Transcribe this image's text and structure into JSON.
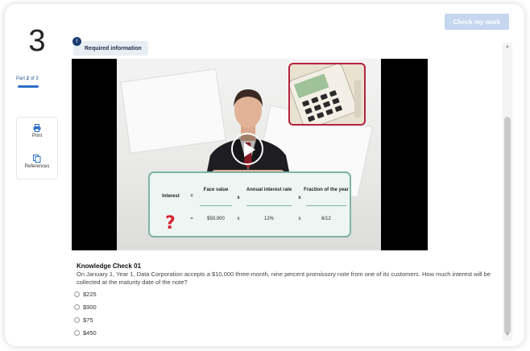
{
  "header": {
    "check_label": "Check my work"
  },
  "question": {
    "number": "3"
  },
  "part": {
    "label": "Part",
    "current": "2",
    "of_text": "of 3"
  },
  "tools": {
    "print_label": "Print",
    "references_label": "References"
  },
  "required": {
    "dot": "!",
    "label": "Required information"
  },
  "formula": {
    "h_interest": "Interest",
    "op1": "=",
    "h_face": "Face value",
    "op2": "x",
    "h_rate": "Annual interest rate",
    "op3": "x",
    "h_fraction": "Fraction of the year",
    "unknown": "?",
    "v_eq": "=",
    "v_face": "$50,000",
    "v_op2": "x",
    "v_rate": "12%",
    "v_op3": "x",
    "v_fraction": "6/12"
  },
  "knowledge_check": {
    "title": "Knowledge Check 01",
    "text": "On January 1, Year 1, Data Corporation accepts a $10,000 three-month, nine percent promissory note from one of its customers. How much interest will be collected at the maturity date of the note?",
    "options": [
      "$225",
      "$900",
      "$75",
      "$450"
    ]
  },
  "colors": {
    "accent": "#2c6fc8",
    "check_button": "#c5d6ee",
    "formula_border": "#7fb3a7",
    "calc_border": "#b62340"
  },
  "icons": {
    "print": "printer-icon",
    "references": "copy-icon",
    "play": "play-icon"
  }
}
